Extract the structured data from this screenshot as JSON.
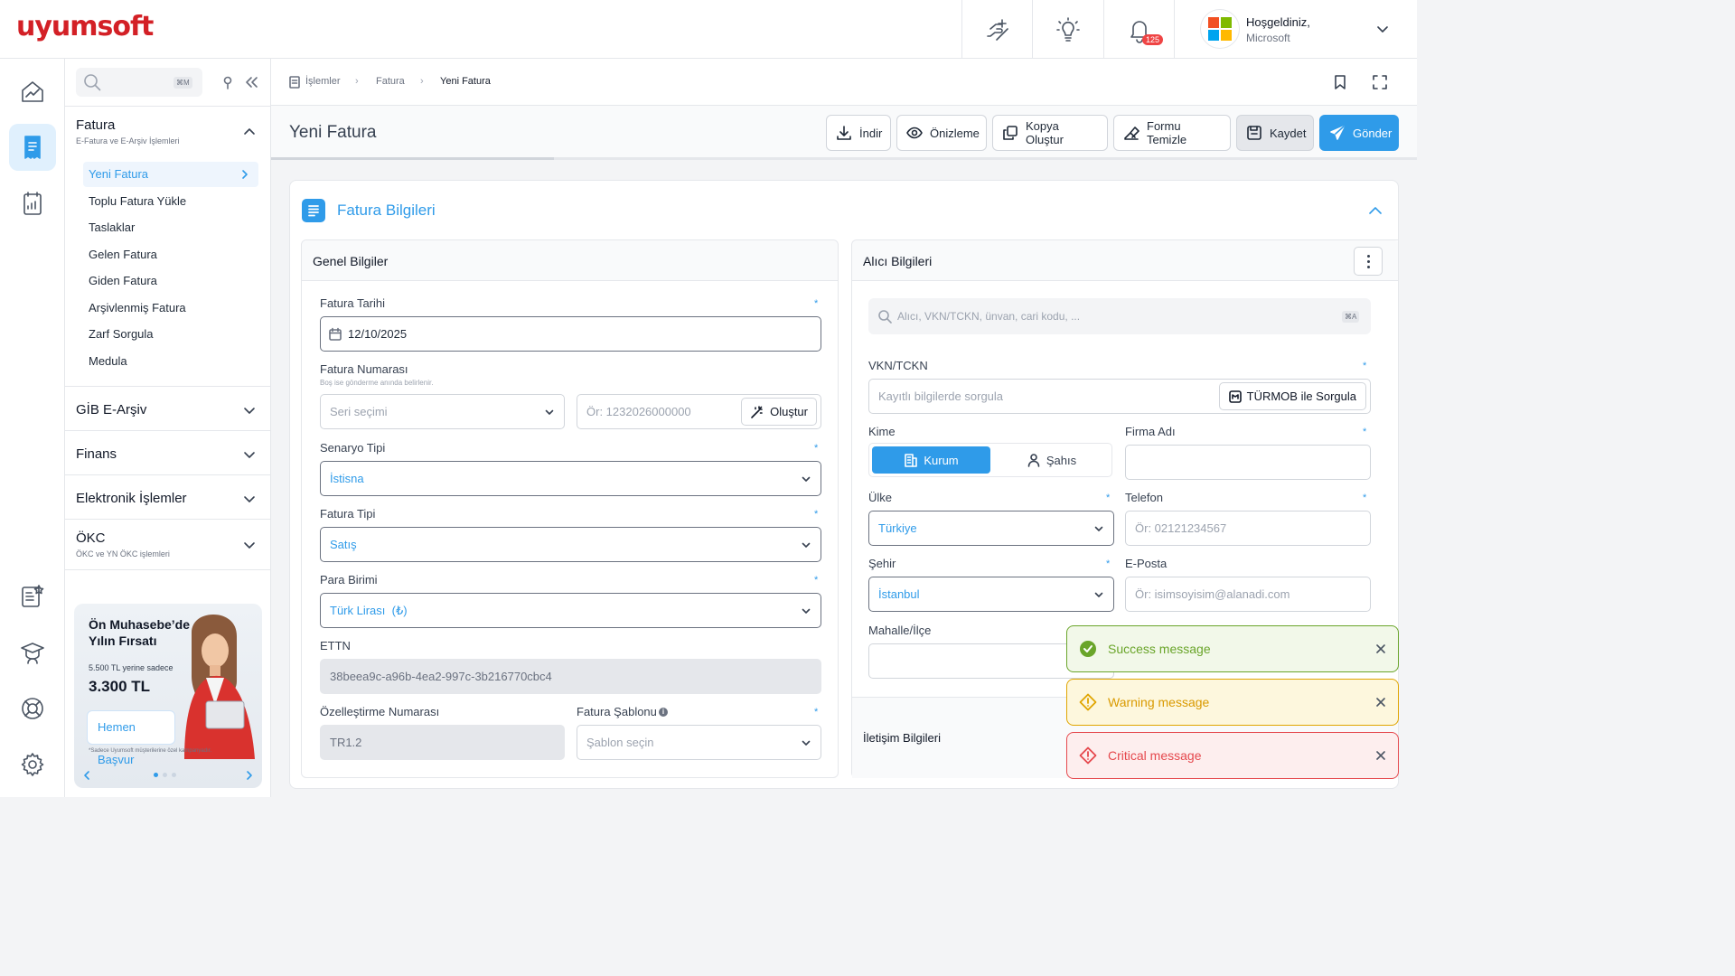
{
  "app": {
    "logo_text": "uyumsoft",
    "brand_color": "#d32026",
    "accent_color": "#2f9be9"
  },
  "header": {
    "notification_count": "125",
    "greeting": "Hoşgeldiniz,",
    "company": "Microsoft",
    "icons": [
      "quick-action-icon",
      "lightbulb-icon",
      "bell-icon"
    ]
  },
  "rail": {
    "icons": [
      "dashboard-icon",
      "invoice-icon",
      "reports-icon",
      "favorites-icon",
      "education-icon",
      "support-icon",
      "settings-icon"
    ]
  },
  "sidebar": {
    "search_shortcut": "⌘M",
    "sections": [
      {
        "title": "Fatura",
        "subtitle": "E-Fatura ve E-Arşiv İşlemleri",
        "items": [
          "Yeni Fatura",
          "Toplu Fatura Yükle",
          "Taslaklar",
          "Gelen Fatura",
          "Giden Fatura",
          "Arşivlenmiş Fatura",
          "Zarf Sorgula",
          "Medula"
        ]
      },
      {
        "title": "GİB E-Arşiv"
      },
      {
        "title": "Finans"
      },
      {
        "title": "Elektronik İşlemler"
      },
      {
        "title": "ÖKC",
        "subtitle": "ÖKC ve YN ÖKC işlemleri"
      }
    ],
    "promo": {
      "title": "Ön Muhasebe’de Yılın Fırsatı",
      "old_price": "5.500 TL yerine sadece",
      "price": "3.300 TL",
      "button": "Hemen Başvur",
      "note": "*Sadece Uyumsoft müşterilerine özel kampanyadır."
    }
  },
  "breadcrumb": [
    "İşlemler",
    "Fatura",
    "Yeni Fatura"
  ],
  "page": {
    "title": "Yeni Fatura",
    "toolbar": {
      "download": "İndir",
      "preview": "Önizleme",
      "copy": "Kopya Oluştur",
      "clear": "Formu Temizle",
      "save": "Kaydet",
      "send": "Gönder"
    }
  },
  "card": {
    "title": "Fatura Bilgileri",
    "general": {
      "title": "Genel Bilgiler",
      "invoice_date_label": "Fatura Tarihi",
      "invoice_date": "12/10/2025",
      "invoice_number_label": "Fatura Numarası",
      "invoice_number_hint": "Boş ise gönderme anında belirlenir.",
      "series_placeholder": "Seri seçimi",
      "number_placeholder": "Ör: 1232026000000",
      "create_button": "Oluştur",
      "scenario_label": "Senaryo Tipi",
      "scenario": "İstisna",
      "invoice_type_label": "Fatura Tipi",
      "invoice_type": "Satış",
      "currency_label": "Para Birimi",
      "currency": "Türk Lirası  (₺)",
      "ettn_label": "ETTN",
      "ettn": "38beea9c-a96b-4ea2-997c-3b216770cbc4",
      "customization_label": "Özelleştirme Numarası",
      "customization": "TR1.2",
      "template_label": "Fatura Şablonu",
      "template_placeholder": "Şablon seçin"
    },
    "receiver": {
      "title": "Alıcı Bilgileri",
      "search_placeholder": "Alıcı, VKN/TCKN, ünvan, cari kodu, ...",
      "search_shortcut": "⌘A",
      "vkn_label": "VKN/TCKN",
      "vkn_placeholder": "Kayıtlı bilgilerde sorgula",
      "turmob_button": "TÜRMOB ile Sorgula",
      "kime_label": "Kime",
      "kime_options": [
        "Kurum",
        "Şahıs"
      ],
      "firm_label": "Firma Adı",
      "country_label": "Ülke",
      "country": "Türkiye",
      "phone_label": "Telefon",
      "phone_placeholder": "Ör: 02121234567",
      "city_label": "Şehir",
      "city": "İstanbul",
      "email_label": "E-Posta",
      "email_placeholder": "Ör: isimsoyisim@alanadi.com",
      "district_label": "Mahalle/İlçe",
      "contact_title": "İletişim Bilgileri"
    }
  },
  "toasts": [
    {
      "type": "success",
      "text": "Success message",
      "color": "#6aa52a",
      "bg": "#f2f8e9"
    },
    {
      "type": "warning",
      "text": "Warning message",
      "color": "#e0a500",
      "bg": "#fdf7dd"
    },
    {
      "type": "critical",
      "text": "Critical message",
      "color": "#e5484d",
      "bg": "#fdeeee"
    }
  ]
}
